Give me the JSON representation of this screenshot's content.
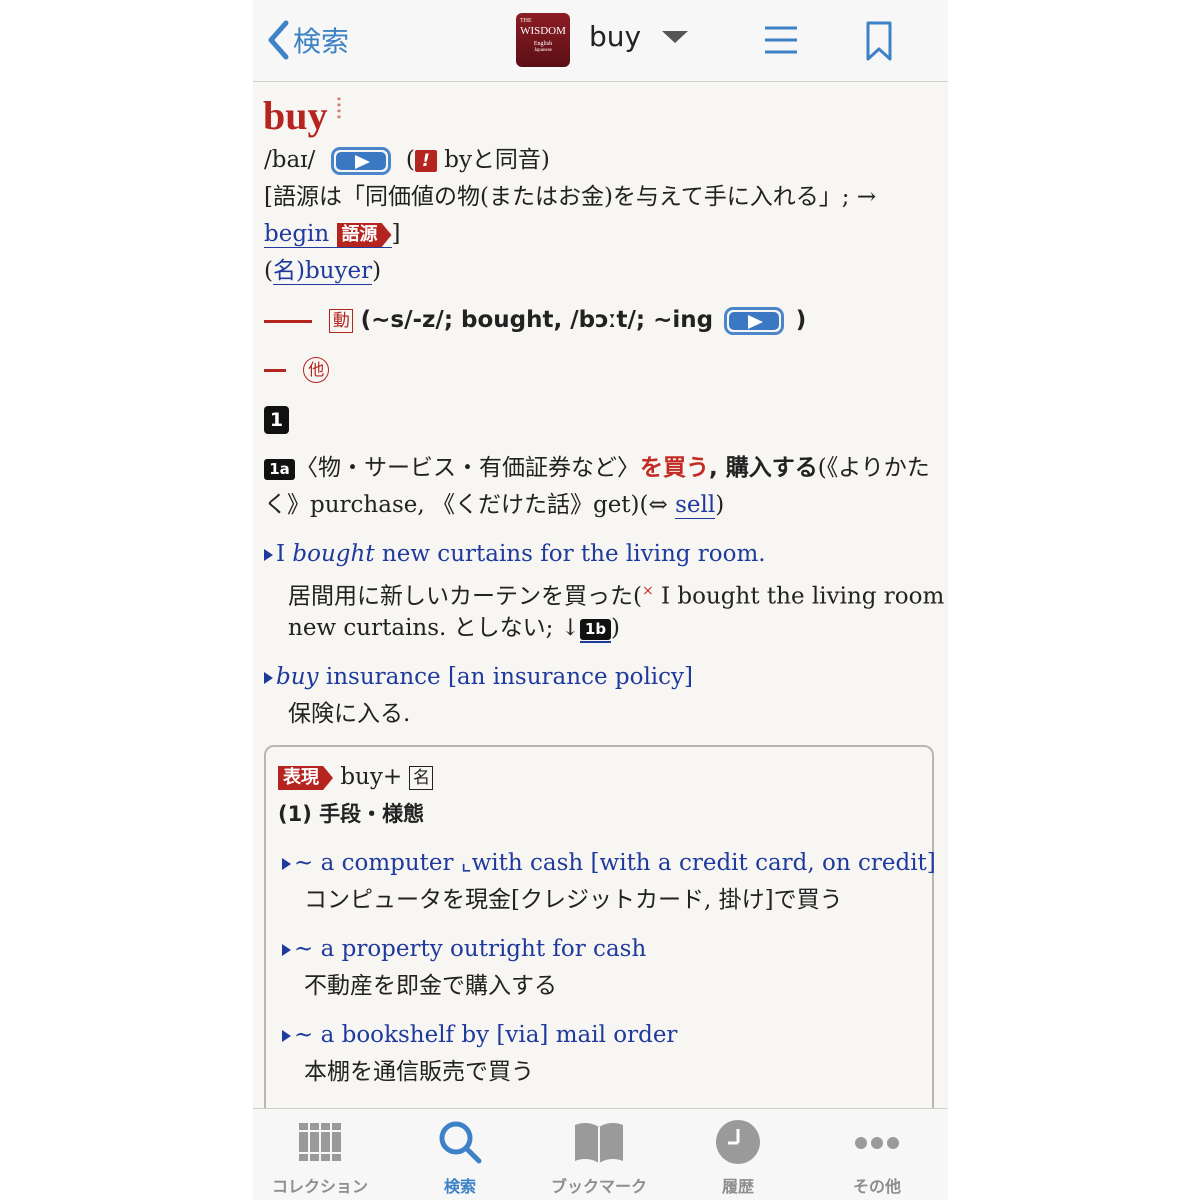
{
  "header": {
    "back_label": "検索",
    "logo": {
      "line1": "THE",
      "line2": "WISDOM",
      "line3": "English",
      "line4": "Japanese"
    },
    "word": "buy"
  },
  "entry": {
    "headword": "buy",
    "pron": "/baɪ/",
    "homophone": "byと同音)",
    "homophone_open": "(",
    "etym_line1": "[語源は「同価値の物(またはお金)を与えて手に入れる」; →",
    "etym_link": "begin",
    "etym_tag": "語源",
    "etym_close": "]",
    "deriv_open": "((",
    "deriv_link": "名)buyer",
    "deriv_close": ")",
    "verb_tag": "動",
    "verb_forms": "(~s/-z/; bought, /bɔːt/; ~ing",
    "verb_close": ")",
    "transitive": "他",
    "sense_num": "1",
    "sense_1a_tag": "1a",
    "sense_1a_scope": "〈物・サービス・有価証券など〉",
    "sense_1a_red": "を買う",
    "sense_1a_bold": ", 購入する",
    "sense_1a_rest1": "(《よりかた",
    "sense_1a_rest2": "く》purchase, 《くだけた話》get)(⇔ ",
    "sense_1a_antonym": "sell",
    "sense_1a_close": ")",
    "ex1_a": "I ",
    "ex1_italic": "bought",
    "ex1_b": " new curtains for the living room.",
    "ex1_jp1": "居間用に新しいカーテンを買った(",
    "ex1_cross": "×",
    "ex1_jp1b": " I bought the living room",
    "ex1_jp2": "new curtains. としない; ↓",
    "ex1_ref": "1b",
    "ex1_close": ")",
    "ex2_italic": "buy",
    "ex2_b": " insurance [an insurance policy]",
    "ex2_jp": "保険に入る."
  },
  "expressions": {
    "tag": "表現",
    "pattern": "buy+",
    "pattern_box": "名",
    "section": "(1) 手段・様態",
    "items": [
      {
        "en": "~ a computer ⌞with cash [with a credit card, on credit]",
        "jp": "コンピュータを現金[クレジットカード, 掛け]で買う"
      },
      {
        "en": "~ a property outright for cash",
        "jp": "不動産を即金で購入する"
      },
      {
        "en": "~ a bookshelf by [via] mail order",
        "jp": "本棚を通信販売で買う"
      }
    ]
  },
  "tabs": [
    {
      "label": "コレクション",
      "icon": "books-icon"
    },
    {
      "label": "検索",
      "icon": "search-icon"
    },
    {
      "label": "ブックマーク",
      "icon": "open-book-icon"
    },
    {
      "label": "履歴",
      "icon": "clock-icon"
    },
    {
      "label": "その他",
      "icon": "more-icon"
    }
  ],
  "colors": {
    "accent": "#3d82c6",
    "entry_red": "#b5241f",
    "example_blue": "#1e3a9c"
  }
}
